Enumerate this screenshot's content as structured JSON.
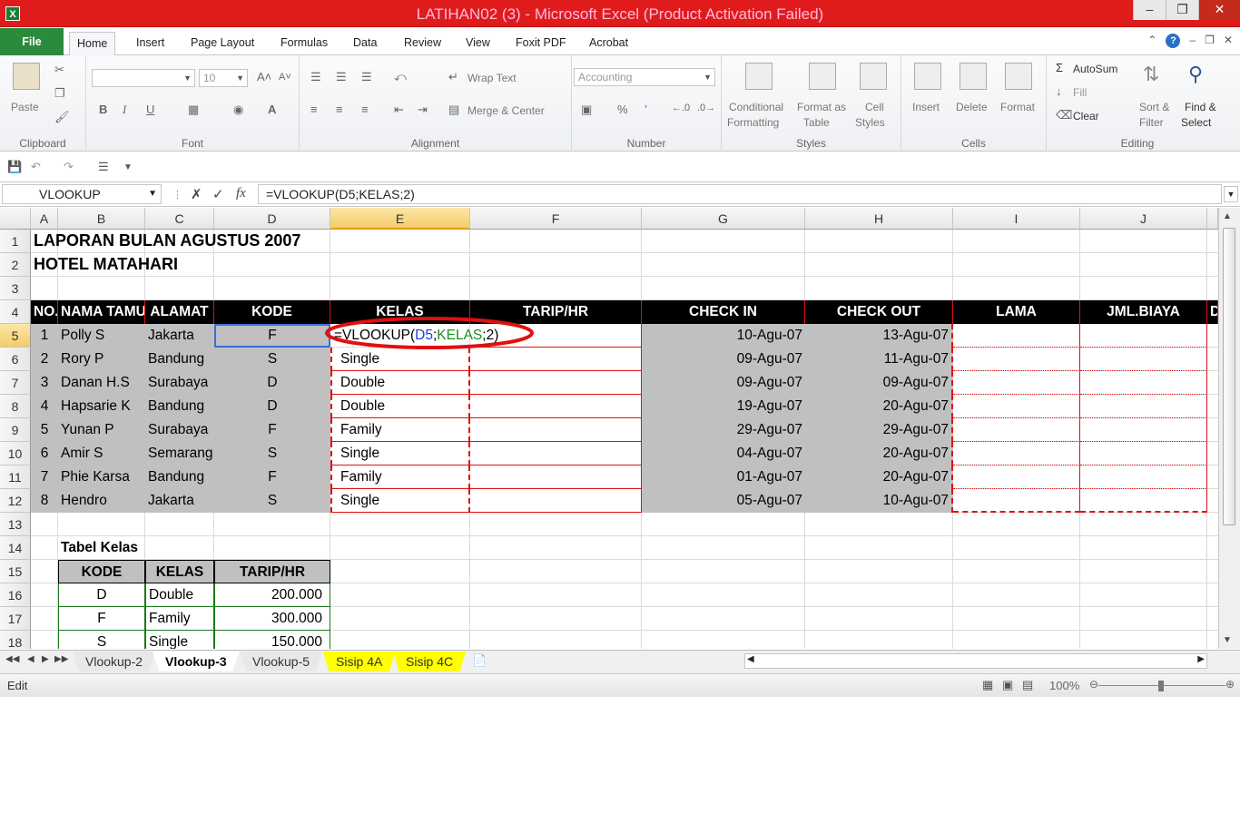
{
  "window": {
    "title": "LATIHAN02 (3)  -  Microsoft Excel (Product Activation Failed)"
  },
  "tabs": [
    "File",
    "Home",
    "Insert",
    "Page Layout",
    "Formulas",
    "Data",
    "Review",
    "View",
    "Foxit PDF",
    "Acrobat"
  ],
  "ribbon": {
    "clipboard": {
      "paste": "Paste",
      "label": "Clipboard"
    },
    "font": {
      "size": "10",
      "label": "Font",
      "bold": "B",
      "italic": "I",
      "underline": "U"
    },
    "alignment": {
      "wrap": "Wrap Text",
      "merge": "Merge & Center",
      "label": "Alignment"
    },
    "number": {
      "format": "Accounting",
      "label": "Number",
      "percent": "%"
    },
    "styles": {
      "cond1": "Conditional",
      "cond2": "Formatting",
      "fmt1": "Format as",
      "fmt2": "Table",
      "cell1": "Cell",
      "cell2": "Styles",
      "label": "Styles"
    },
    "cells": {
      "insert": "Insert",
      "delete": "Delete",
      "format": "Format",
      "label": "Cells"
    },
    "editing": {
      "autosum": "AutoSum",
      "fill": "Fill",
      "clear": "Clear",
      "sort1": "Sort &",
      "sort2": "Filter",
      "find1": "Find &",
      "find2": "Select",
      "label": "Editing"
    }
  },
  "formulabar": {
    "name": "VLOOKUP",
    "fx": "fx",
    "formula": "=VLOOKUP(D5;KELAS;2)"
  },
  "columns": [
    "A",
    "B",
    "C",
    "D",
    "E",
    "F",
    "G",
    "H",
    "I",
    "J"
  ],
  "rows": [
    "1",
    "2",
    "3",
    "4",
    "5",
    "6",
    "7",
    "8",
    "9",
    "10",
    "11",
    "12",
    "13",
    "14",
    "15",
    "16",
    "17",
    "18"
  ],
  "sheet": {
    "title1": "LAPORAN BULAN AGUSTUS 2007",
    "title2": "HOTEL MATAHARI",
    "headers": [
      "NO.",
      "NAMA TAMU",
      "ALAMAT",
      "KODE",
      "KELAS",
      "TARIP/HR",
      "CHECK IN",
      "CHECK OUT",
      "LAMA",
      "JML.BIAYA",
      "D"
    ],
    "data": [
      {
        "no": "1",
        "nama": "Polly S",
        "alamat": "Jakarta",
        "kode": "F",
        "kelas": "",
        "in": "10-Agu-07",
        "out": "13-Agu-07"
      },
      {
        "no": "2",
        "nama": "Rory P",
        "alamat": "Bandung",
        "kode": "S",
        "kelas": "Single",
        "in": "09-Agu-07",
        "out": "11-Agu-07"
      },
      {
        "no": "3",
        "nama": "Danan H.S",
        "alamat": "Surabaya",
        "kode": "D",
        "kelas": "Double",
        "in": "09-Agu-07",
        "out": "09-Agu-07"
      },
      {
        "no": "4",
        "nama": "Hapsarie K",
        "alamat": "Bandung",
        "kode": "D",
        "kelas": "Double",
        "in": "19-Agu-07",
        "out": "20-Agu-07"
      },
      {
        "no": "5",
        "nama": "Yunan P",
        "alamat": "Surabaya",
        "kode": "F",
        "kelas": "Family",
        "in": "29-Agu-07",
        "out": "29-Agu-07"
      },
      {
        "no": "6",
        "nama": "Amir S",
        "alamat": "Semarang",
        "kode": "S",
        "kelas": "Single",
        "in": "04-Agu-07",
        "out": "20-Agu-07"
      },
      {
        "no": "7",
        "nama": "Phie Karsa",
        "alamat": "Bandung",
        "kode": "F",
        "kelas": "Family",
        "in": "01-Agu-07",
        "out": "20-Agu-07"
      },
      {
        "no": "8",
        "nama": "Hendro",
        "alamat": "Jakarta",
        "kode": "S",
        "kelas": "Single",
        "in": "05-Agu-07",
        "out": "10-Agu-07"
      }
    ],
    "editing_formula": {
      "prefix": "=VLOOKUP(",
      "ref1": "D5",
      "sep1": ";",
      "ref2": "KELAS",
      "suffix": ";2)"
    },
    "lookup_title": "Tabel Kelas",
    "lookup_headers": [
      "KODE",
      "KELAS",
      "TARIP/HR"
    ],
    "lookup_rows": [
      {
        "kode": "D",
        "kelas": "Double",
        "tarip": "200.000"
      },
      {
        "kode": "F",
        "kelas": "Family",
        "tarip": "300.000"
      },
      {
        "kode": "S",
        "kelas": "Single",
        "tarip": "150.000"
      }
    ]
  },
  "sheet_tabs": [
    "Vlookup-2",
    "Vlookup-3",
    "Vlookup-5",
    "Sisip 4A",
    "Sisip 4C"
  ],
  "status": {
    "mode": "Edit",
    "zoom": "100%"
  },
  "colors": {
    "title_bar": "#e01b1b",
    "file_tab": "#2a8b3c",
    "header_fill": "#000000",
    "data_fill": "#c0c0c0",
    "highlight": "#e01010"
  }
}
